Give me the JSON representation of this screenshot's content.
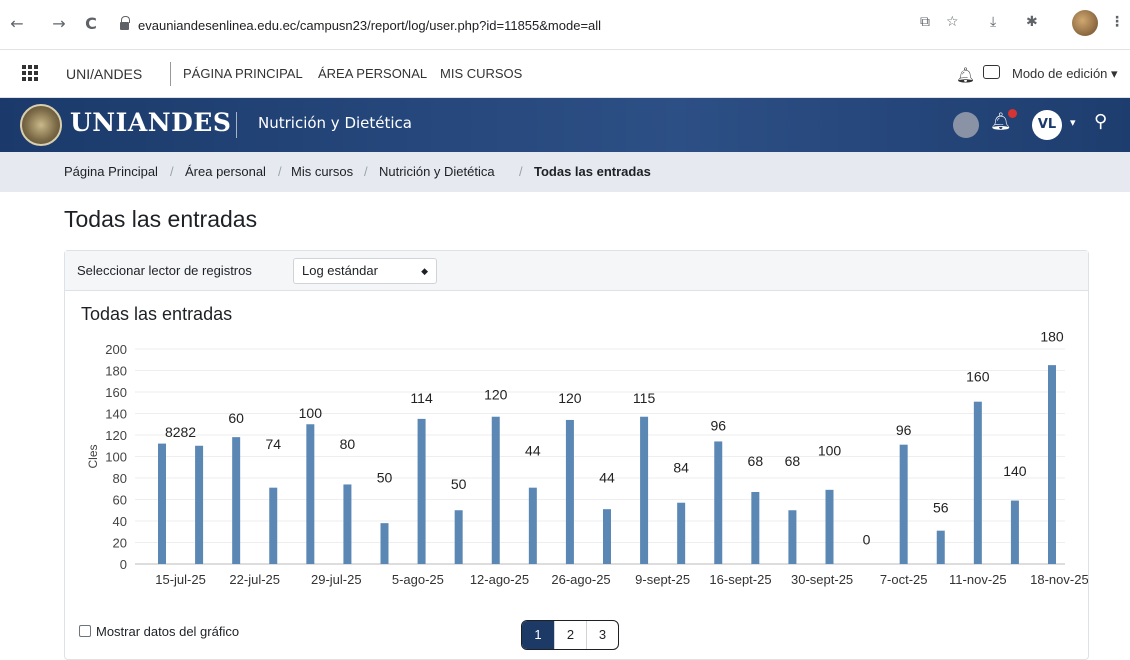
{
  "browser": {
    "url": "evauniandesenlinea.edu.ec/campusn23/report/log/user.php?id=11855&mode=all",
    "back": "←",
    "forward": "→",
    "reload": "C"
  },
  "topnav": {
    "logo": "UNI/ANDES",
    "links": [
      "PÁGINA PRINCIPAL",
      "ÁREA PERSONAL",
      "MIS CURSOS"
    ],
    "edit_mode": "Modo de edición ▾"
  },
  "banner": {
    "brand": "UNIANDES",
    "course": "Nutrición y Dietética",
    "user_initials": "VL"
  },
  "breadcrumb": [
    "Página Principal",
    "Área personal",
    "Mis cursos",
    "Nutrición y Dietética",
    "Todas las entradas"
  ],
  "page_title": "Todas las entradas",
  "log_selector": {
    "label": "Seleccionar lector de registros",
    "value": "Log estándar"
  },
  "chart_title": "Todas las entradas",
  "chart_data": {
    "type": "bar",
    "title": "Todas las entradas",
    "ylabel": "Cles",
    "ylim": [
      0,
      200
    ],
    "yticks": [
      0,
      20,
      40,
      60,
      80,
      100,
      120,
      140,
      160,
      180,
      200
    ],
    "xticks": [
      "15-jul-25",
      "22-jul-25",
      "29-jul-25",
      "5-ago-25",
      "12-ago-25",
      "26-ago-25",
      "9-sept-25",
      "16-sept-25",
      "30-sept-25",
      "7-oct-25",
      "11-nov-25",
      "18-nov-25"
    ],
    "values": [
      112,
      110,
      118,
      71,
      130,
      74,
      38,
      135,
      50,
      137,
      71,
      134,
      51,
      137,
      57,
      114,
      67,
      50,
      69,
      0,
      111,
      31,
      151,
      59,
      185
    ],
    "data_labels": [
      "8282",
      "60",
      "74",
      "100",
      "80",
      "50",
      "114",
      "50",
      "120",
      "44",
      "120",
      "44",
      "115",
      "84",
      "96",
      "68",
      "68",
      "100",
      "0",
      "96",
      "56",
      "160",
      "140",
      "180"
    ]
  },
  "show_data_label": "Mostrar datos del gráfico",
  "pagination": [
    "1",
    "2",
    "3"
  ]
}
